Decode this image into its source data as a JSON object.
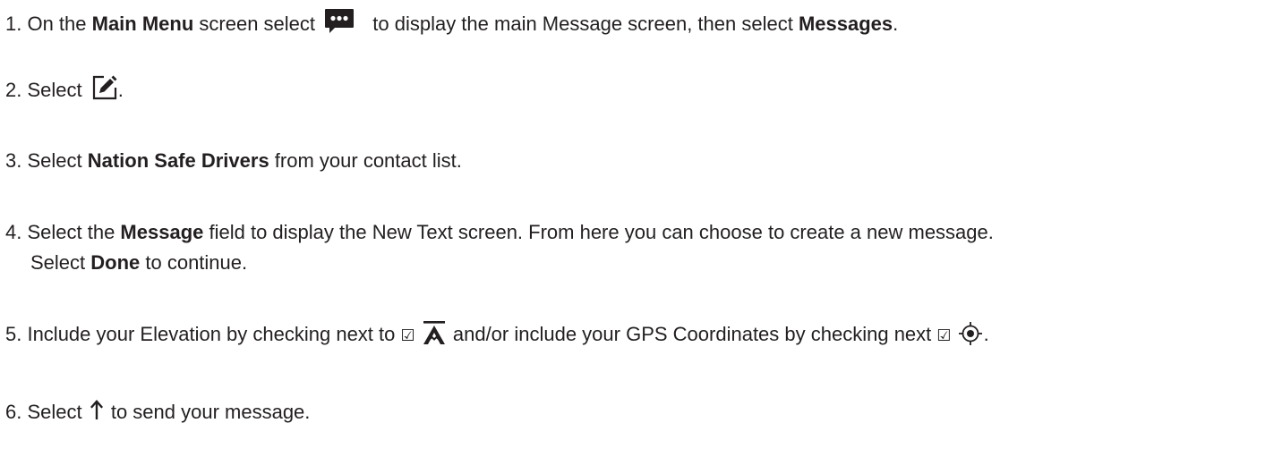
{
  "steps": [
    {
      "s1_a": "1. On the ",
      "s1_b": "Main Menu",
      "s1_c": " screen select ",
      "s1_icon": "message-bubble-icon",
      "s1_d": " to display the main Message screen, then select ",
      "s1_e": "Messages",
      "s1_f": "."
    },
    {
      "s2_a": "2. Select ",
      "s2_icon": "compose-icon",
      "s2_b": "."
    },
    {
      "s3_a": "3. Select ",
      "s3_b": "Nation Safe Drivers",
      "s3_c": " from your contact list."
    },
    {
      "s4_a": "4. Select the ",
      "s4_b": "Message",
      "s4_c": " field to display the New Text screen. From here you can choose to create a new message.",
      "s4_d": "Select ",
      "s4_e": "Done",
      "s4_f": " to continue."
    },
    {
      "s5_a": "5. Include your Elevation by checking next to ",
      "s5_check1": "☑",
      "s5_icon1": "elevation-icon",
      "s5_b": " and/or include your GPS Coordinates by checking next ",
      "s5_check2": "☑",
      "s5_icon2": "gps-target-icon",
      "s5_c": "."
    },
    {
      "s6_a": "6. Select ",
      "s6_arrow": "↑",
      "s6_icon": "up-arrow-icon",
      "s6_b": " to send your message."
    }
  ]
}
